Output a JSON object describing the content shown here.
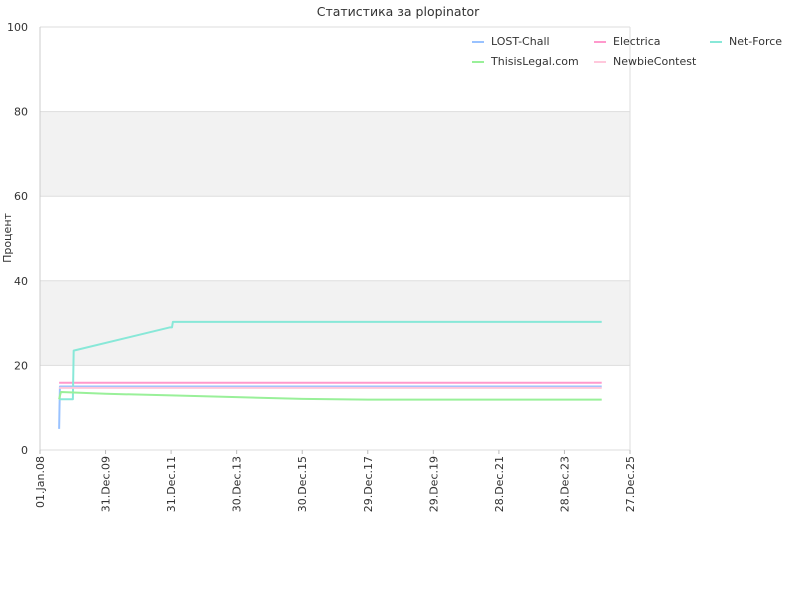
{
  "chart_data": {
    "type": "line",
    "title": "Статистика за plopinator",
    "ylabel": "Процент",
    "xlabel": "",
    "ylim": [
      0,
      100
    ],
    "yticks": [
      0,
      20,
      40,
      60,
      80,
      100
    ],
    "xlim": [
      "2008-01-01",
      "2025-12-27"
    ],
    "xticks": [
      {
        "label": "01.Jan.08",
        "date": "2008-01-01"
      },
      {
        "label": "31.Dec.09",
        "date": "2009-12-31"
      },
      {
        "label": "31.Dec.11",
        "date": "2011-12-31"
      },
      {
        "label": "30.Dec.13",
        "date": "2013-12-30"
      },
      {
        "label": "30.Dec.15",
        "date": "2015-12-30"
      },
      {
        "label": "29.Dec.17",
        "date": "2017-12-29"
      },
      {
        "label": "29.Dec.19",
        "date": "2019-12-29"
      },
      {
        "label": "28.Dec.21",
        "date": "2021-12-28"
      },
      {
        "label": "28.Dec.23",
        "date": "2023-12-28"
      },
      {
        "label": "27.Dec.25",
        "date": "2025-12-27"
      }
    ],
    "banded_background": true,
    "legend_position": "top-right",
    "series": [
      {
        "name": "LOST-Chall",
        "color": "#99c2ff",
        "points": [
          [
            "2008-08-01",
            5
          ],
          [
            "2008-08-05",
            10
          ],
          [
            "2008-08-10",
            15
          ],
          [
            "2025-02-15",
            15
          ]
        ]
      },
      {
        "name": "Electrica",
        "color": "#ff99cc",
        "points": [
          [
            "2008-08-01",
            15.9
          ],
          [
            "2025-02-15",
            15.9
          ]
        ]
      },
      {
        "name": "Net-Force",
        "color": "#88e8d8",
        "points": [
          [
            "2008-08-01",
            12
          ],
          [
            "2009-01-01",
            12
          ],
          [
            "2009-01-10",
            23.5
          ],
          [
            "2011-12-20",
            29
          ],
          [
            "2012-01-10",
            29
          ],
          [
            "2012-01-20",
            30.3
          ],
          [
            "2025-02-15",
            30.3
          ]
        ]
      },
      {
        "name": "ThisisLegal.com",
        "color": "#99f099",
        "points": [
          [
            "2008-08-01",
            12
          ],
          [
            "2008-08-20",
            13.7
          ],
          [
            "2010-01-01",
            13.3
          ],
          [
            "2012-01-01",
            12.9
          ],
          [
            "2014-01-01",
            12.5
          ],
          [
            "2016-01-01",
            12.1
          ],
          [
            "2018-01-01",
            11.9
          ],
          [
            "2025-02-15",
            11.9
          ]
        ]
      },
      {
        "name": "NewbieContest",
        "color": "#ffc8dc",
        "points": [
          [
            "2008-08-01",
            14.7
          ],
          [
            "2025-02-15",
            14.7
          ]
        ]
      }
    ]
  }
}
